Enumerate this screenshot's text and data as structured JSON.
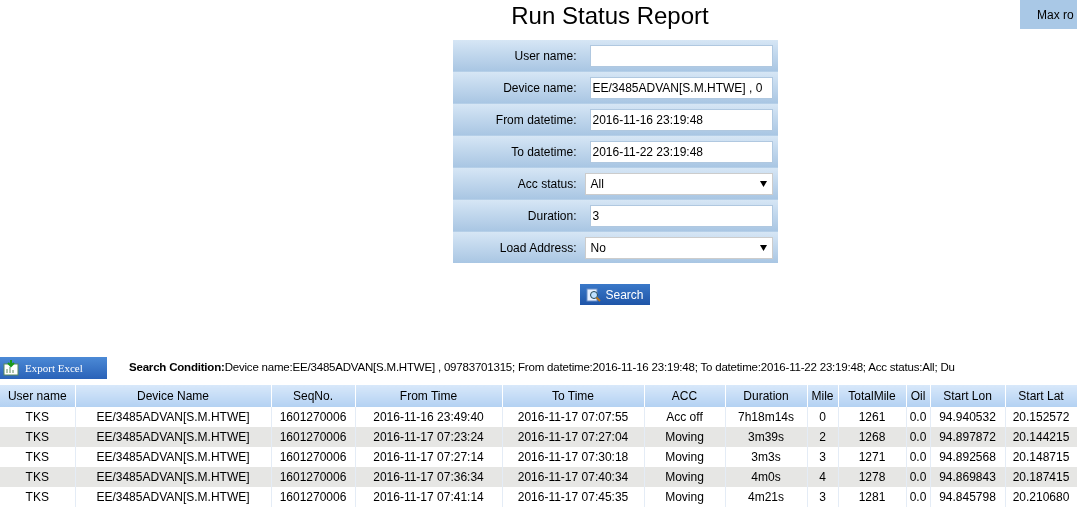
{
  "title": "Run Status Report",
  "corner_button": "Max ro",
  "form": [
    {
      "label": "User name:",
      "kind": "text"
    },
    {
      "label": "Device name:",
      "kind": "text",
      "value": "EE/3485ADVAN[S.M.HTWE] , 0"
    },
    {
      "label": "From datetime:",
      "kind": "text",
      "value": "2016-11-16 23:19:48"
    },
    {
      "label": "To datetime:",
      "kind": "text",
      "value": "2016-11-22 23:19:48"
    },
    {
      "label": "Acc status:",
      "kind": "select",
      "value": "All"
    },
    {
      "label": "Duration:",
      "kind": "text",
      "value": "3"
    },
    {
      "label": "Load Address:",
      "kind": "select",
      "value": "No"
    }
  ],
  "search_button": "Search",
  "export_button": "Export Excel",
  "search_condition": "**Search Condition:**Device name:EE/3485ADVAN[S.M.HTWE] , 09783701315; From datetime:2016-11-16 23:19:48; To datetime:2016-11-22 23:19:48; Acc status:All; Du",
  "table": {
    "columns": [
      "User name",
      "Device Name",
      "SeqNo.",
      "From Time",
      "To Time",
      "ACC",
      "Duration",
      "Mile",
      "TotalMile",
      "Oil",
      "Start Lon",
      "Start Lat"
    ],
    "rows": [
      [
        "TKS",
        "EE/3485ADVAN[S.M.HTWE]",
        "1601270006",
        "2016-11-16 23:49:40",
        "2016-11-17 07:07:55",
        "Acc off",
        "7h18m14s",
        "0",
        "1261",
        "0.0",
        "94.940532",
        "20.152572"
      ],
      [
        "TKS",
        "EE/3485ADVAN[S.M.HTWE]",
        "1601270006",
        "2016-11-17 07:23:24",
        "2016-11-17 07:27:04",
        "Moving",
        "3m39s",
        "2",
        "1268",
        "0.0",
        "94.897872",
        "20.144215"
      ],
      [
        "TKS",
        "EE/3485ADVAN[S.M.HTWE]",
        "1601270006",
        "2016-11-17 07:27:14",
        "2016-11-17 07:30:18",
        "Moving",
        "3m3s",
        "3",
        "1271",
        "0.0",
        "94.892568",
        "20.148715"
      ],
      [
        "TKS",
        "EE/3485ADVAN[S.M.HTWE]",
        "1601270006",
        "2016-11-17 07:36:34",
        "2016-11-17 07:40:34",
        "Moving",
        "4m0s",
        "4",
        "1278",
        "0.0",
        "94.869843",
        "20.187415"
      ],
      [
        "TKS",
        "EE/3485ADVAN[S.M.HTWE]",
        "1601270006",
        "2016-11-17 07:41:14",
        "2016-11-17 07:45:35",
        "Moving",
        "4m21s",
        "3",
        "1281",
        "0.0",
        "94.845798",
        "20.210680"
      ]
    ]
  }
}
